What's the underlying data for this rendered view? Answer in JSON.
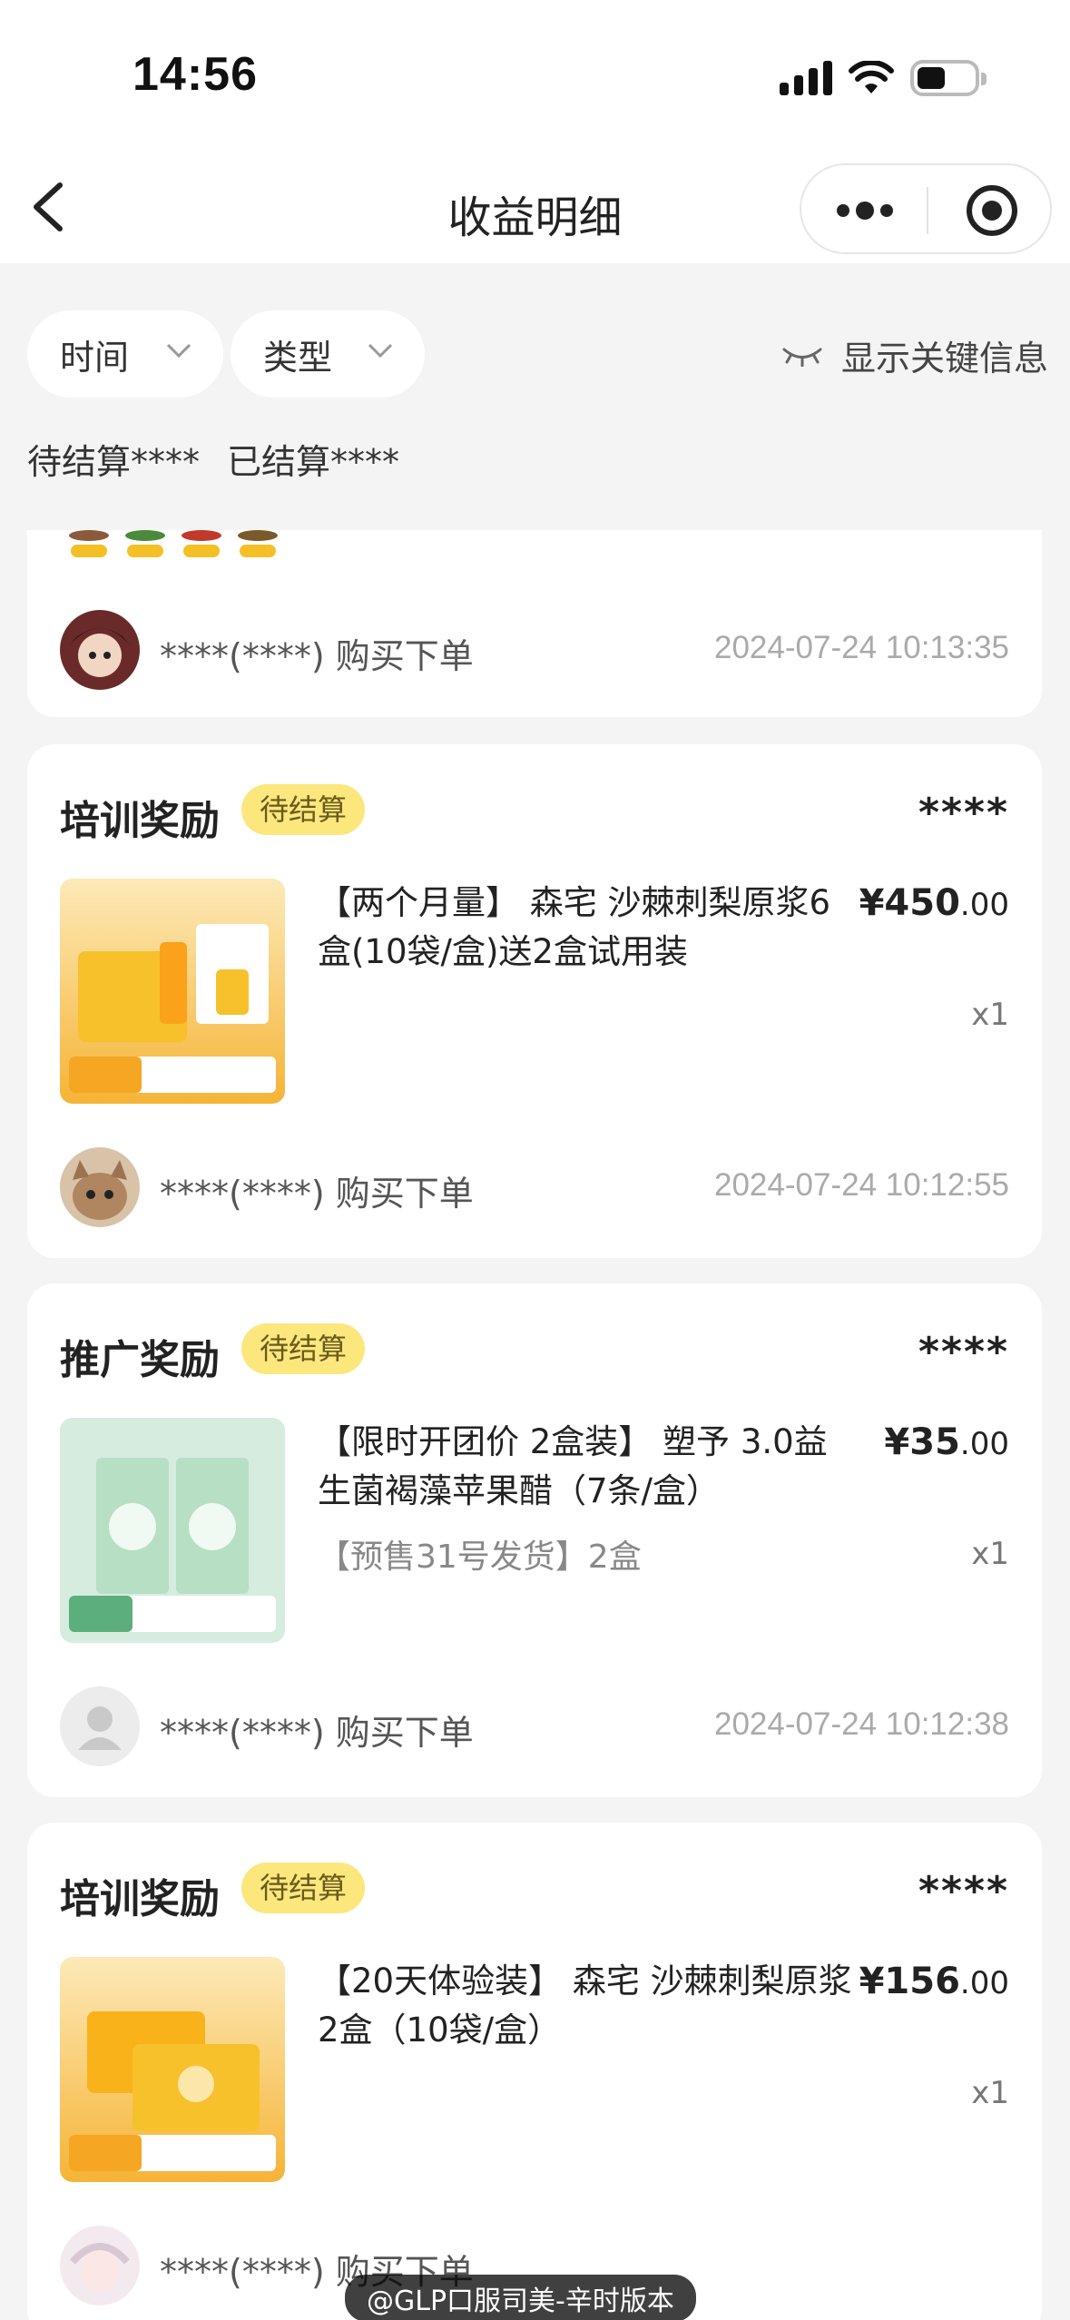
{
  "status_bar": {
    "time": "14:56"
  },
  "nav": {
    "title": "收益明细"
  },
  "filters": {
    "time_label": "时间",
    "type_label": "类型",
    "toggle_label": "显示关键信息"
  },
  "summary": {
    "pending": "待结算****",
    "settled": "已结算****"
  },
  "records": [
    {
      "buyer": "****(****) 购买下单",
      "date": "2024-07-24 10:13:35"
    },
    {
      "title": "培训奖励",
      "badge": "待结算",
      "amount": "****",
      "product": "【两个月量】 森宅 沙棘刺梨原浆6盒(10袋/盒)送2盒试用装",
      "note": "",
      "price_main": "¥450",
      "price_decimal": ".00",
      "qty": "x1",
      "buyer": "****(****) 购买下单",
      "date": "2024-07-24 10:12:55"
    },
    {
      "title": "推广奖励",
      "badge": "待结算",
      "amount": "****",
      "product": "【限时开团价 2盒装】 塑予 3.0益生菌褐藻苹果醋（7条/盒）",
      "note": "【预售31号发货】2盒",
      "price_main": "¥35",
      "price_decimal": ".00",
      "qty": "x1",
      "buyer": "****(****) 购买下单",
      "date": "2024-07-24 10:12:38"
    },
    {
      "title": "培训奖励",
      "badge": "待结算",
      "amount": "****",
      "product": "【20天体验装】 森宅 沙棘刺梨原浆 2盒（10袋/盒）",
      "note": "",
      "price_main": "¥156",
      "price_decimal": ".00",
      "qty": "x1",
      "buyer": "****(****) 购买下单",
      "date": ""
    }
  ],
  "watermark": "@GLP口服司美-辛时版本",
  "colors": {
    "badge_bg": "#fbe77c",
    "page_bg": "#f4f4f4"
  }
}
